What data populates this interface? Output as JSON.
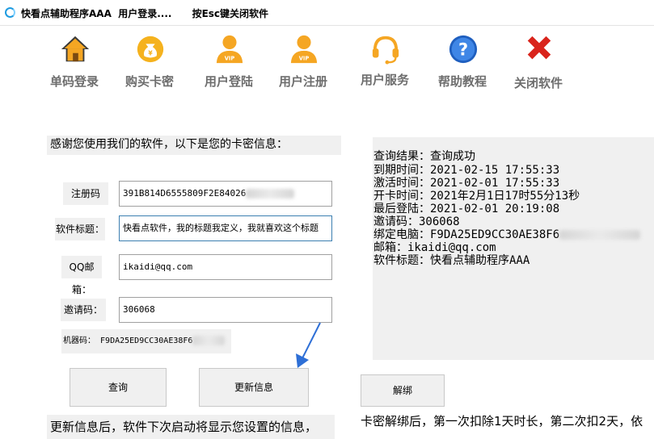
{
  "window": {
    "title_app": "快看点辅助程序AAA",
    "title_status": "用户登录....",
    "title_hint": "按Esc键关闭软件"
  },
  "toolbar": {
    "items": [
      {
        "label": "单码登录",
        "icon": "home-icon"
      },
      {
        "label": "购买卡密",
        "icon": "money-bag-icon"
      },
      {
        "label": "用户登陆",
        "icon": "vip-user-icon"
      },
      {
        "label": "用户注册",
        "icon": "vip-user-icon"
      },
      {
        "label": "用户服务",
        "icon": "headset-icon"
      },
      {
        "label": "帮助教程",
        "icon": "help-icon"
      },
      {
        "label": "关闭软件",
        "icon": "close-icon"
      }
    ]
  },
  "intro": "感谢您使用我们的软件，以下是您的卡密信息：",
  "form": {
    "reg_code_label": "注册码",
    "reg_code_value": "391B814D6555809F2E84026",
    "title_label": "软件标题：",
    "title_value": "快看点软件，我的标题我定义，我就喜欢这个标题",
    "email_label": "QQ邮箱：",
    "email_value": "ikaidi@qq.com",
    "invite_label": "邀请码：",
    "invite_value": "306068",
    "machine_label": "机器码：",
    "machine_value": "F9DA25ED9CC30AE38F6"
  },
  "buttons": {
    "query": "查询",
    "update": "更新信息",
    "unbind": "解绑"
  },
  "result": {
    "lines": [
      "查询结果：查询成功",
      "到期时间：2021-02-15 17:55:33",
      "激活时间：2021-02-01 17:55:33",
      "开卡时间：2021年2月1日17时55分13秒",
      "最后登陆：2021-02-01 20:19:08",
      "邀请码：306068",
      "绑定电脑：F9DA25ED9CC30AE38F6",
      "邮箱：ikaidi@qq.com",
      "软件标题：快看点辅助程序AAA"
    ]
  },
  "footer": {
    "left": "更新信息后，软件下次启动将显示您设置的信息，",
    "right": "卡密解绑后，第一次扣除1天时长，第二次扣2天，依"
  },
  "colors": {
    "toolbar_label": "#6e6e6e",
    "panel_bg": "#f0f0f0",
    "accent_blue": "#2e6fd6",
    "home_orange": "#f5a623",
    "close_red": "#d9241c"
  }
}
